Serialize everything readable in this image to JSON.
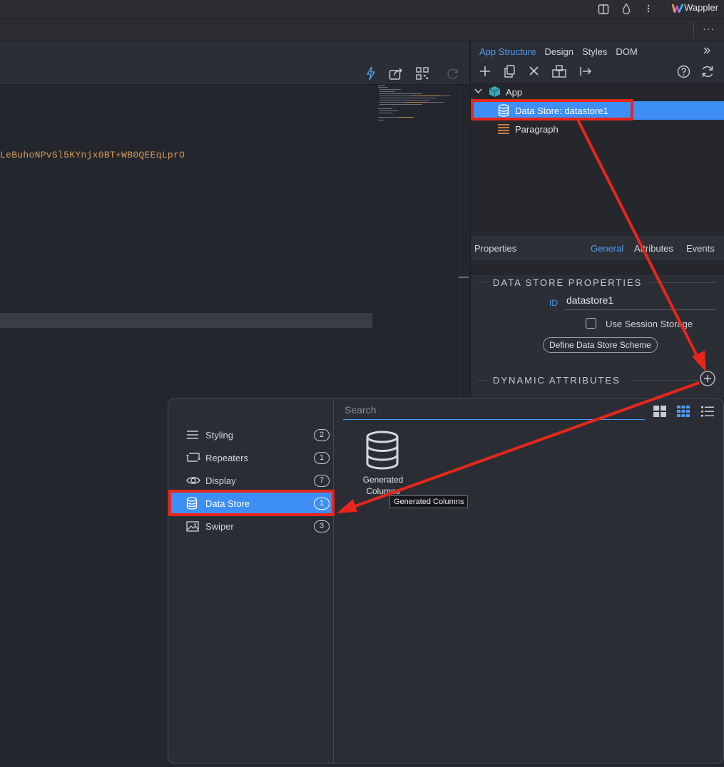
{
  "app": {
    "brand": "Wappler"
  },
  "editor": {
    "code_line": "LeBuhoNPvSl5KYnjx0BT+WB0QEEqLprO"
  },
  "right_panel": {
    "tabs": [
      {
        "label": "App Structure",
        "active": true
      },
      {
        "label": "Design",
        "active": false
      },
      {
        "label": "Styles",
        "active": false
      },
      {
        "label": "DOM",
        "active": false
      }
    ],
    "tree": {
      "root": "App",
      "items": [
        {
          "label": "Data Store: datastore1",
          "selected": true
        },
        {
          "label": "Paragraph",
          "selected": false
        }
      ]
    },
    "properties": {
      "title": "Properties",
      "tabs": [
        {
          "label": "General",
          "active": true
        },
        {
          "label": "Attributes",
          "active": false
        },
        {
          "label": "Events",
          "active": false
        }
      ],
      "section_title": "DATA STORE PROPERTIES",
      "id_label": "ID",
      "id_value": "datastore1",
      "session_storage_label": "Use Session Storage",
      "session_storage_checked": false,
      "define_button": "Define Data Store Scheme",
      "dynamic_section_title": "DYNAMIC ATTRIBUTES"
    }
  },
  "popup": {
    "search_placeholder": "Search",
    "categories": [
      {
        "label": "Styling",
        "count": "2",
        "icon": "lines-icon",
        "selected": false
      },
      {
        "label": "Repeaters",
        "count": "1",
        "icon": "repeat-icon",
        "selected": false
      },
      {
        "label": "Display",
        "count": "7",
        "icon": "eye-icon",
        "selected": false
      },
      {
        "label": "Data Store",
        "count": "1",
        "icon": "database-icon",
        "selected": true
      },
      {
        "label": "Swiper",
        "count": "3",
        "icon": "image-icon",
        "selected": false
      }
    ],
    "item": {
      "label_line1": "Generated",
      "label_line2": "Columns",
      "icon": "database-icon"
    },
    "tooltip": "Generated Columns"
  },
  "colors": {
    "accent": "#3d8ef5",
    "highlight": "#e8261b",
    "code": "#d79a5a"
  }
}
